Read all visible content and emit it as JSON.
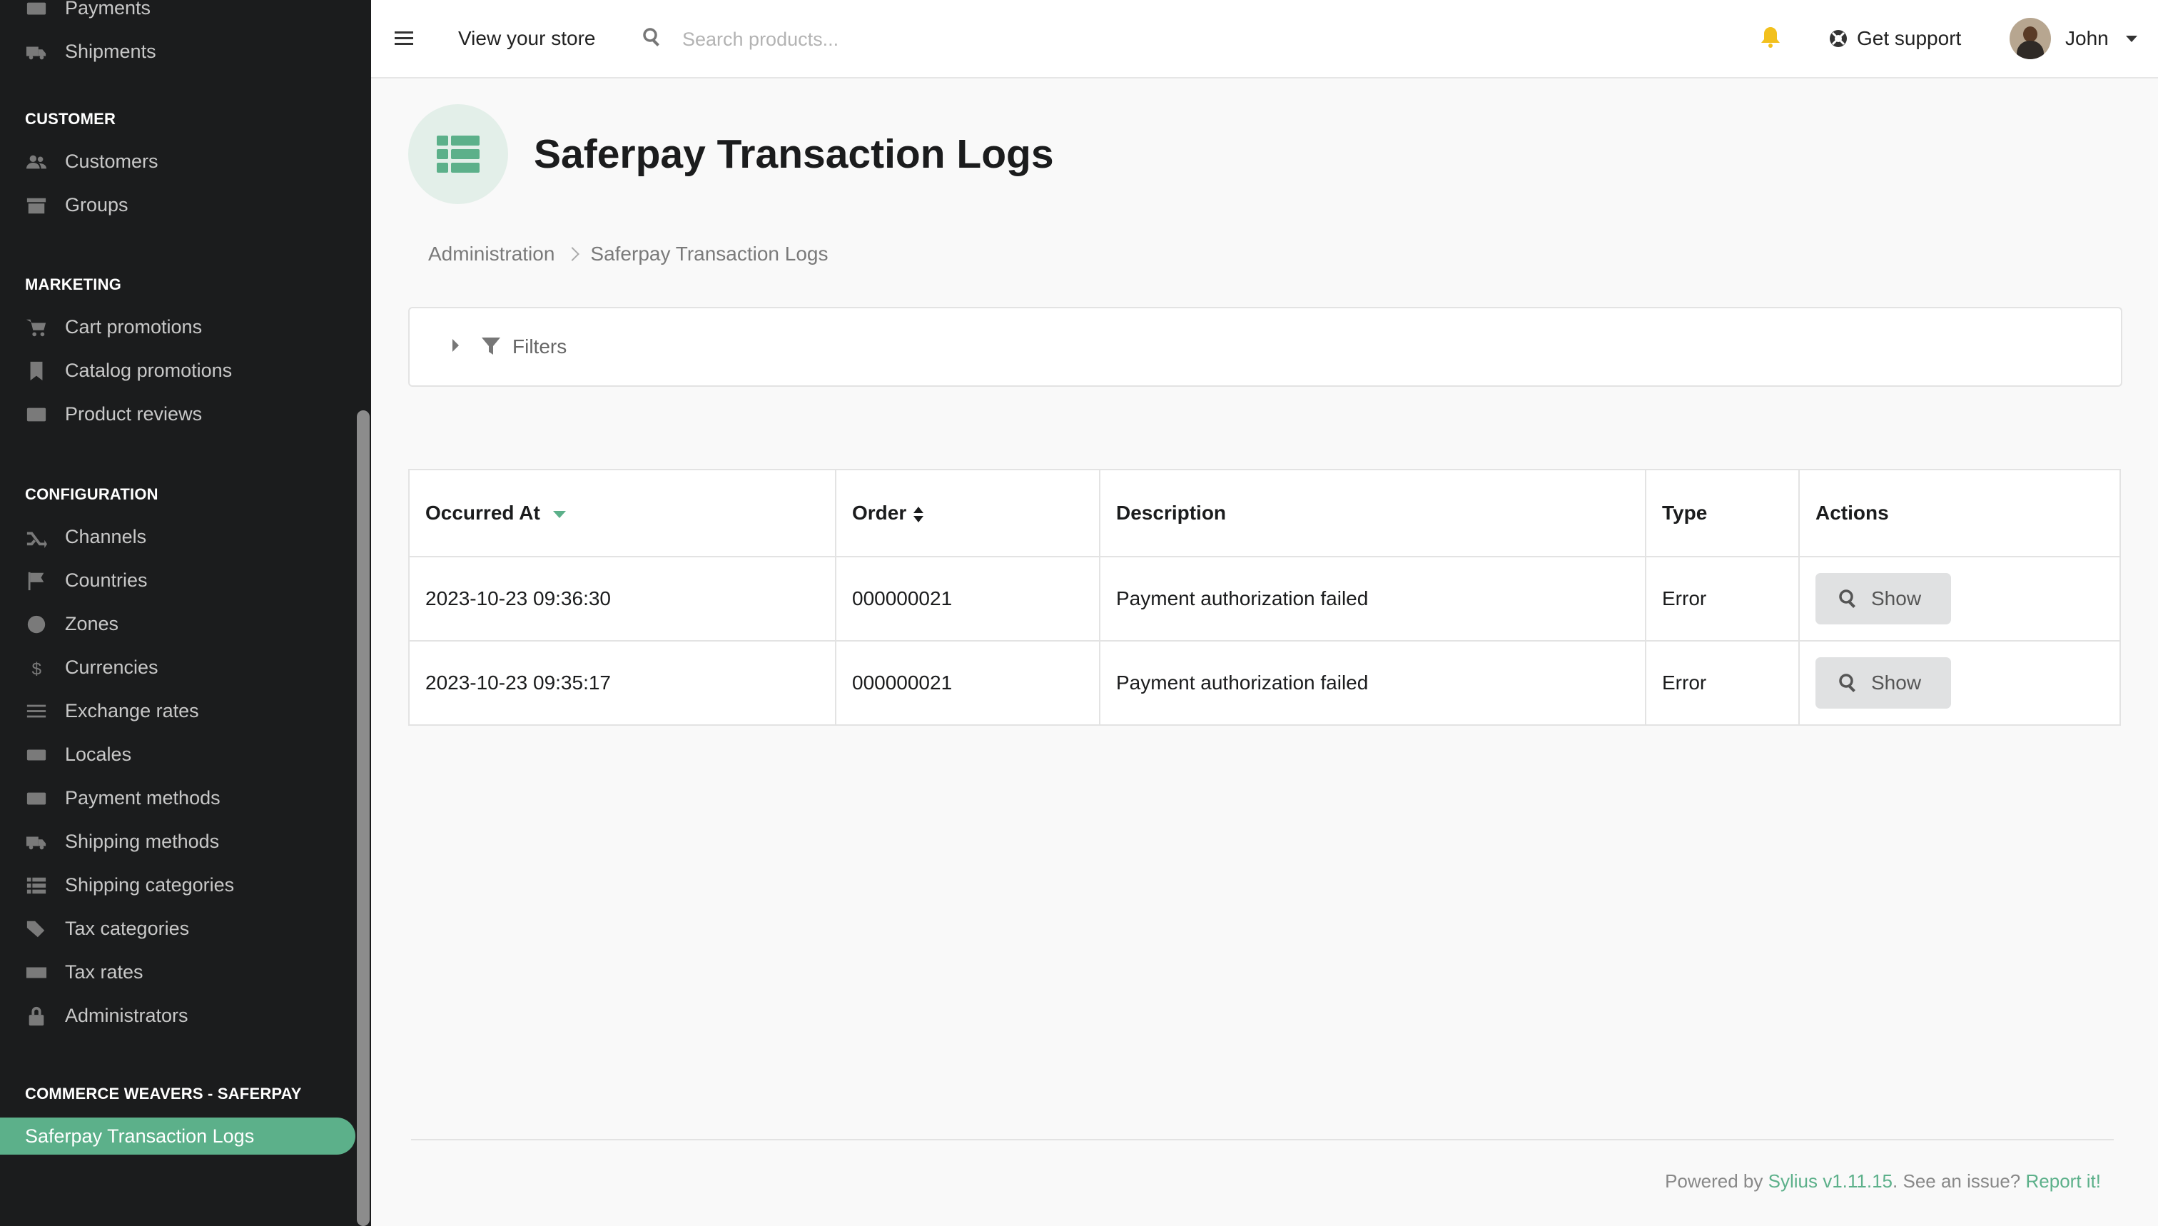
{
  "colors": {
    "accent": "#5cb08a",
    "sidebar_bg": "#1b1c1d",
    "bell": "#f2c01d"
  },
  "sidebar": {
    "top_items": [
      {
        "label": "Payments",
        "icon": "payment-icon"
      },
      {
        "label": "Shipments",
        "icon": "truck-icon"
      }
    ],
    "sections": [
      {
        "title": "CUSTOMER",
        "items": [
          {
            "label": "Customers",
            "icon": "users-icon"
          },
          {
            "label": "Groups",
            "icon": "archive-icon"
          }
        ]
      },
      {
        "title": "MARKETING",
        "items": [
          {
            "label": "Cart promotions",
            "icon": "cart-icon"
          },
          {
            "label": "Catalog promotions",
            "icon": "bookmark-icon"
          },
          {
            "label": "Product reviews",
            "icon": "newspaper-icon"
          }
        ]
      },
      {
        "title": "CONFIGURATION",
        "items": [
          {
            "label": "Channels",
            "icon": "random-icon"
          },
          {
            "label": "Countries",
            "icon": "flag-icon"
          },
          {
            "label": "Zones",
            "icon": "globe-icon"
          },
          {
            "label": "Currencies",
            "icon": "dollar-icon"
          },
          {
            "label": "Exchange rates",
            "icon": "sliders-icon"
          },
          {
            "label": "Locales",
            "icon": "language-icon"
          },
          {
            "label": "Payment methods",
            "icon": "credit-card-icon"
          },
          {
            "label": "Shipping methods",
            "icon": "shipping-icon"
          },
          {
            "label": "Shipping categories",
            "icon": "list-icon"
          },
          {
            "label": "Tax categories",
            "icon": "tags-icon"
          },
          {
            "label": "Tax rates",
            "icon": "money-icon"
          },
          {
            "label": "Administrators",
            "icon": "lock-icon"
          }
        ]
      },
      {
        "title": "COMMERCE WEAVERS - SAFERPAY",
        "items": [
          {
            "label": "Saferpay Transaction Logs",
            "icon": "",
            "active": true
          }
        ]
      }
    ]
  },
  "topbar": {
    "view_store": "View your store",
    "search_placeholder": "Search products...",
    "support": "Get support",
    "user_name": "John"
  },
  "page": {
    "title": "Saferpay Transaction Logs",
    "breadcrumb": [
      "Administration",
      "Saferpay Transaction Logs"
    ],
    "filters_label": "Filters"
  },
  "table": {
    "columns": [
      "Occurred At",
      "Order",
      "Description",
      "Type",
      "Actions"
    ],
    "rows": [
      {
        "occurred_at": "2023-10-23 09:36:30",
        "order": "000000021",
        "description": "Payment authorization failed",
        "type": "Error",
        "action": "Show"
      },
      {
        "occurred_at": "2023-10-23 09:35:17",
        "order": "000000021",
        "description": "Payment authorization failed",
        "type": "Error",
        "action": "Show"
      }
    ]
  },
  "footer": {
    "powered_by": "Powered by",
    "sylius_link": "Sylius v1.11.15",
    "issue_text": ". See an issue?",
    "report_link": "Report it!"
  }
}
